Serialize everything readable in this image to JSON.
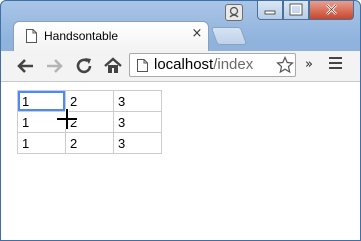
{
  "tab": {
    "title": "Handsontable",
    "close": "×"
  },
  "toolbar": {
    "url_host": "localhost",
    "url_path": "/index",
    "overflow": "»"
  },
  "grid": {
    "rows": [
      [
        "1",
        "2",
        "3"
      ],
      [
        "1",
        "2",
        "3"
      ],
      [
        "1",
        "2",
        "3"
      ]
    ],
    "selected": [
      0,
      0
    ]
  },
  "colors": {
    "selection": "#4b89ff",
    "grid_border": "#cccccc",
    "frame": "#8fb3dd"
  }
}
